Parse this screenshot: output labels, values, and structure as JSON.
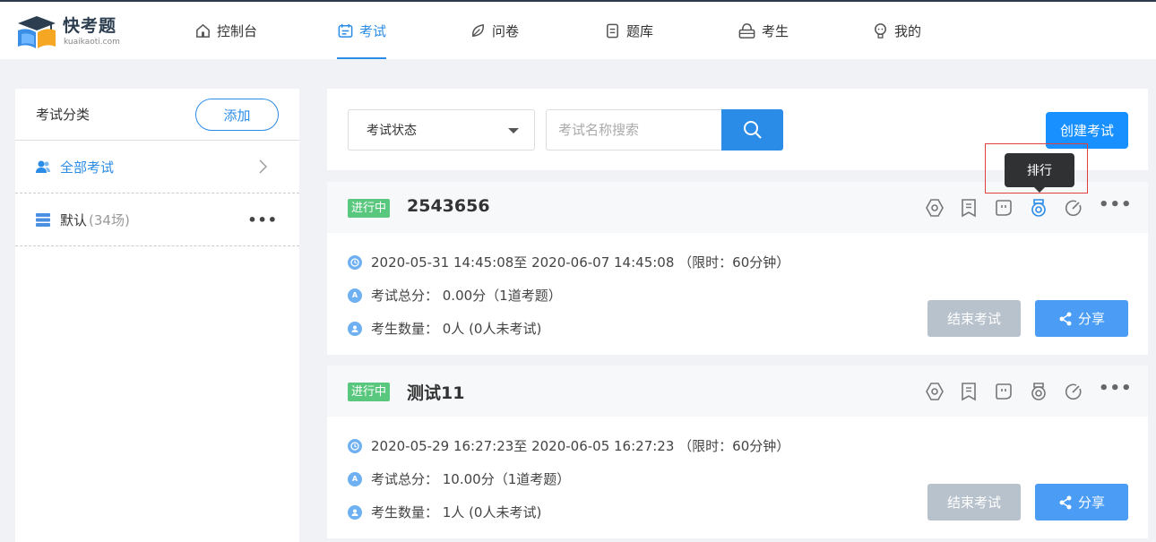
{
  "brand": {
    "title": "快考题",
    "subtitle": "kuaikaoti.com"
  },
  "nav": [
    {
      "label": "控制台",
      "icon": "home-icon"
    },
    {
      "label": "考试",
      "icon": "calendar-icon",
      "active": true
    },
    {
      "label": "问卷",
      "icon": "leaf-icon"
    },
    {
      "label": "题库",
      "icon": "database-icon"
    },
    {
      "label": "考生",
      "icon": "person-icon"
    },
    {
      "label": "我的",
      "icon": "bulb-icon"
    }
  ],
  "sidebar": {
    "title": "考试分类",
    "add_label": "添加",
    "items": [
      {
        "label": "全部考试",
        "count": ""
      },
      {
        "label": "默认",
        "count": "(34场)"
      }
    ]
  },
  "filter": {
    "status_select": "考试状态",
    "search_placeholder": "考试名称搜索",
    "create_label": "创建考试"
  },
  "tooltip": "排行",
  "exams": [
    {
      "status": "进行中",
      "title": "2543656",
      "time": "2020-05-31 14:45:08至 2020-06-07 14:45:08 （限时：60分钟）",
      "score": "考试总分： 0.00分（1道考题）",
      "count": "考生数量： 0人 (0人未考试)",
      "end_label": "结束考试",
      "share_label": "分享"
    },
    {
      "status": "进行中",
      "title": "测试11",
      "time": "2020-05-29 16:27:23至 2020-06-05 16:27:23 （限时：60分钟）",
      "score": "考试总分： 10.00分（1道考题）",
      "count": "考生数量： 1人 (0人未考试)",
      "end_label": "结束考试",
      "share_label": "分享"
    }
  ],
  "colors": {
    "accent": "#2b8ce8",
    "status_green": "#5ac77e",
    "disabled": "#b8c2cc"
  }
}
